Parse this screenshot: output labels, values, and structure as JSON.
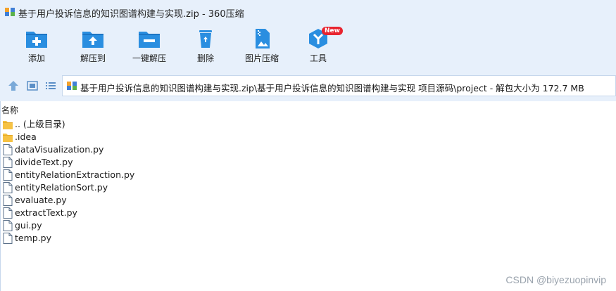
{
  "window": {
    "title": "基于用户投诉信息的知识图谱构建与实现.zip - 360压缩"
  },
  "toolbar": {
    "add": "添加",
    "extract_to": "解压到",
    "one_click_extract": "一键解压",
    "delete": "删除",
    "image_compress": "图片压缩",
    "tools": "工具",
    "tools_badge": "New"
  },
  "address_bar": {
    "path": "基于用户投诉信息的知识图谱构建与实现.zip\\基于用户投诉信息的知识图谱构建与实现 项目源码\\project - 解包大小为 172.7 MB"
  },
  "file_list": {
    "column_name": "名称",
    "items": [
      {
        "name": ".. (上级目录)",
        "type": "parent"
      },
      {
        "name": ".idea",
        "type": "folder"
      },
      {
        "name": "dataVisualization.py",
        "type": "file"
      },
      {
        "name": "divideText.py",
        "type": "file"
      },
      {
        "name": "entityRelationExtraction.py",
        "type": "file"
      },
      {
        "name": "entityRelationSort.py",
        "type": "file"
      },
      {
        "name": "evaluate.py",
        "type": "file"
      },
      {
        "name": "extractText.py",
        "type": "file"
      },
      {
        "name": "gui.py",
        "type": "file"
      },
      {
        "name": "temp.py",
        "type": "file"
      }
    ]
  },
  "watermark": "CSDN @biyezuopinvip",
  "colors": {
    "accent": "#2a8ee0",
    "chrome": "#e7f0fb",
    "folder": "#f6c243"
  }
}
